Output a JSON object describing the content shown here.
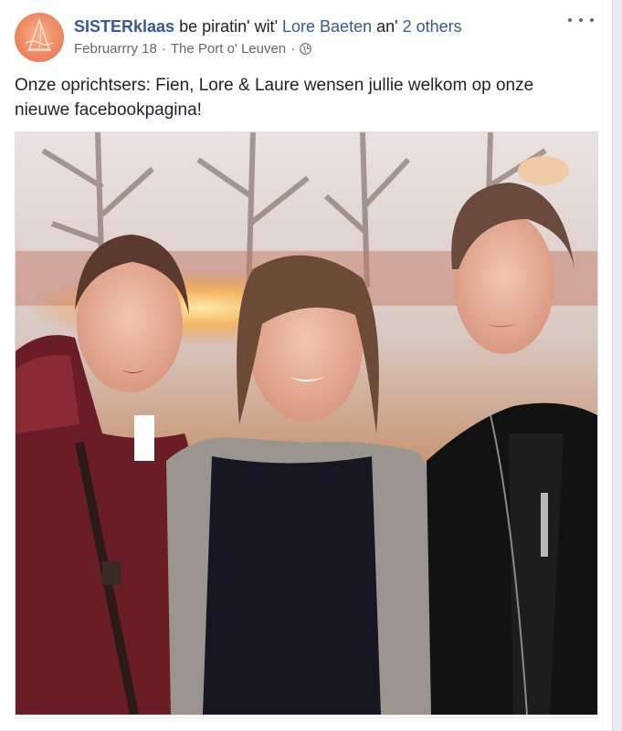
{
  "post": {
    "author": "SISTERklaas",
    "verb": "be piratin' wit'",
    "tagged_person": "Lore Baeten",
    "connector": "an'",
    "others": "2 others",
    "date": "Februarrry 18",
    "location": "The Port o' Leuven",
    "separator": "·",
    "privacy_icon": "globe-icon",
    "text": "Onze oprichtsers: Fien, Lore & Laure wensen jullie welkom op onze nieuwe facebookpagina!"
  },
  "colors": {
    "link": "#365899",
    "meta": "#616770",
    "text": "#1d2129",
    "avatar": "#ee8a63"
  },
  "photo": {
    "subject_count": 3,
    "icon": "photo"
  }
}
